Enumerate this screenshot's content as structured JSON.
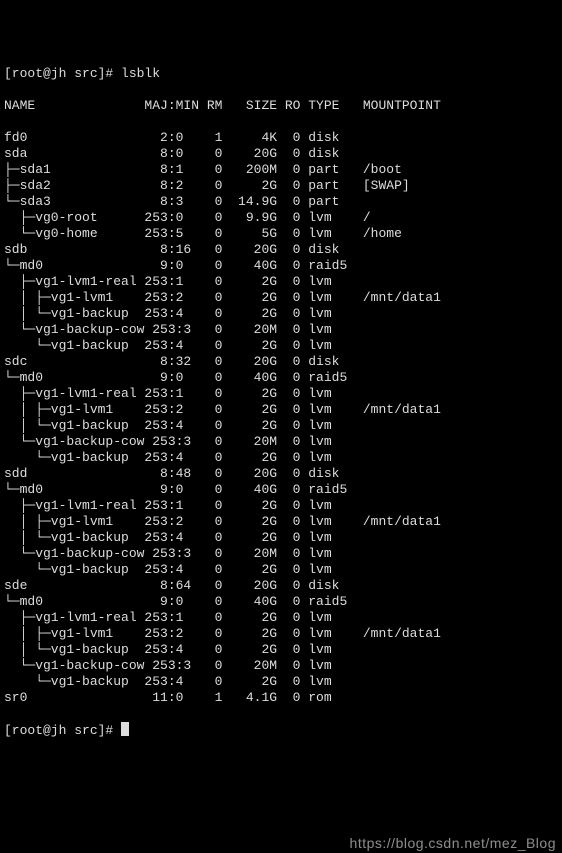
{
  "prompt1": "[root@jh src]# lsblk",
  "header": "NAME              MAJ:MIN RM   SIZE RO TYPE   MOUNTPOINT",
  "rows": [
    "fd0                 2:0    1     4K  0 disk",
    "sda                 8:0    0    20G  0 disk",
    "├─sda1              8:1    0   200M  0 part   /boot",
    "├─sda2              8:2    0     2G  0 part   [SWAP]",
    "└─sda3              8:3    0  14.9G  0 part",
    "  ├─vg0-root      253:0    0   9.9G  0 lvm    /",
    "  └─vg0-home      253:5    0     5G  0 lvm    /home",
    "sdb                 8:16   0    20G  0 disk",
    "└─md0               9:0    0    40G  0 raid5",
    "  ├─vg1-lvm1-real 253:1    0     2G  0 lvm",
    "  │ ├─vg1-lvm1    253:2    0     2G  0 lvm    /mnt/data1",
    "  │ └─vg1-backup  253:4    0     2G  0 lvm",
    "  └─vg1-backup-cow 253:3   0    20M  0 lvm",
    "    └─vg1-backup  253:4    0     2G  0 lvm",
    "sdc                 8:32   0    20G  0 disk",
    "└─md0               9:0    0    40G  0 raid5",
    "  ├─vg1-lvm1-real 253:1    0     2G  0 lvm",
    "  │ ├─vg1-lvm1    253:2    0     2G  0 lvm    /mnt/data1",
    "  │ └─vg1-backup  253:4    0     2G  0 lvm",
    "  └─vg1-backup-cow 253:3   0    20M  0 lvm",
    "    └─vg1-backup  253:4    0     2G  0 lvm",
    "sdd                 8:48   0    20G  0 disk",
    "└─md0               9:0    0    40G  0 raid5",
    "  ├─vg1-lvm1-real 253:1    0     2G  0 lvm",
    "  │ ├─vg1-lvm1    253:2    0     2G  0 lvm    /mnt/data1",
    "  │ └─vg1-backup  253:4    0     2G  0 lvm",
    "  └─vg1-backup-cow 253:3   0    20M  0 lvm",
    "    └─vg1-backup  253:4    0     2G  0 lvm",
    "sde                 8:64   0    20G  0 disk",
    "└─md0               9:0    0    40G  0 raid5",
    "  ├─vg1-lvm1-real 253:1    0     2G  0 lvm",
    "  │ ├─vg1-lvm1    253:2    0     2G  0 lvm    /mnt/data1",
    "  │ └─vg1-backup  253:4    0     2G  0 lvm",
    "  └─vg1-backup-cow 253:3   0    20M  0 lvm",
    "    └─vg1-backup  253:4    0     2G  0 lvm",
    "sr0                11:0    1   4.1G  0 rom"
  ],
  "prompt2": "[root@jh src]# ",
  "watermark": "https://blog.csdn.net/mez_Blog"
}
